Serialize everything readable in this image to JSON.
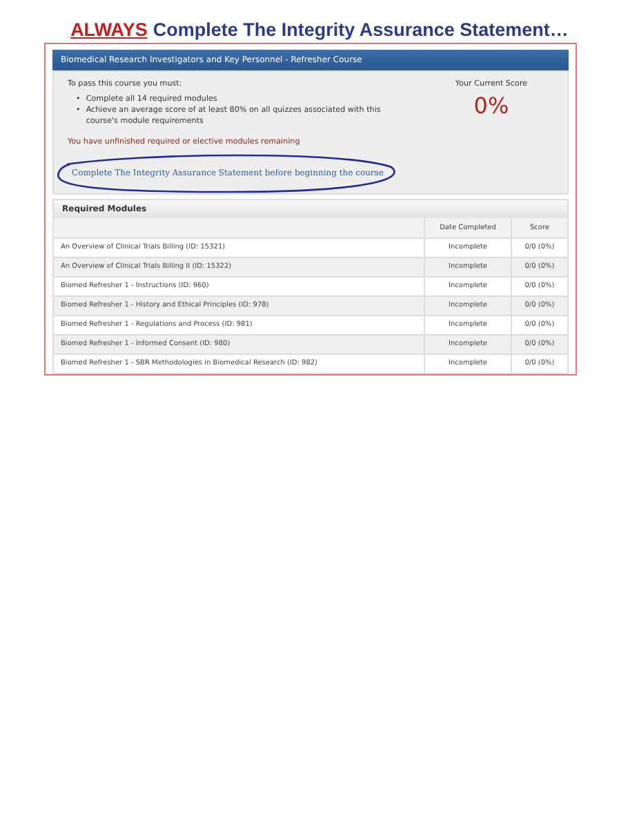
{
  "heading": {
    "emphasis": "ALWAYS",
    "text": "Complete The Integrity Assurance Statement…"
  },
  "course": {
    "title": "Biomedical Research Investigators and Key Personnel - Refresher Course",
    "intro": "To pass this course you must:",
    "requirements": [
      {
        "bullet": "•",
        "text": "Complete all 14 required modules"
      },
      {
        "bullet": "•",
        "text": "Achieve an average score of at least 80% on all quizzes associated with this course's module requirements"
      }
    ],
    "score_label": "Your Current Score",
    "score": "0%",
    "warning": "You have unfinished required or elective modules remaining",
    "link": "Complete The Integrity Assurance Statement before beginning the course"
  },
  "modules": {
    "title": "Required Modules",
    "columns": [
      "Date Completed",
      "Score"
    ],
    "rows": [
      {
        "name": "An Overview of Clinical Trials Billing (ID: 15321)",
        "date": "Incomplete",
        "score": "0/0 (0%)"
      },
      {
        "name": "An Overview of Clinical Trials Billing II (ID: 15322)",
        "date": "Incomplete",
        "score": "0/0 (0%)"
      },
      {
        "name": "Biomed Refresher 1 - Instructions (ID: 960)",
        "date": "Incomplete",
        "score": "0/0 (0%)"
      },
      {
        "name": "Biomed Refresher 1 - History and Ethical Principles (ID: 978)",
        "date": "Incomplete",
        "score": "0/0 (0%)"
      },
      {
        "name": "Biomed Refresher 1 - Regulations and Process (ID: 981)",
        "date": "Incomplete",
        "score": "0/0 (0%)"
      },
      {
        "name": "Biomed Refresher 1 - Informed Consent (ID: 980)",
        "date": "Incomplete",
        "score": "0/0 (0%)"
      },
      {
        "name": "Biomed Refresher 1 - SBR Methodologies in Biomedical Research (ID: 982)",
        "date": "Incomplete",
        "score": "0/0 (0%)"
      }
    ]
  }
}
